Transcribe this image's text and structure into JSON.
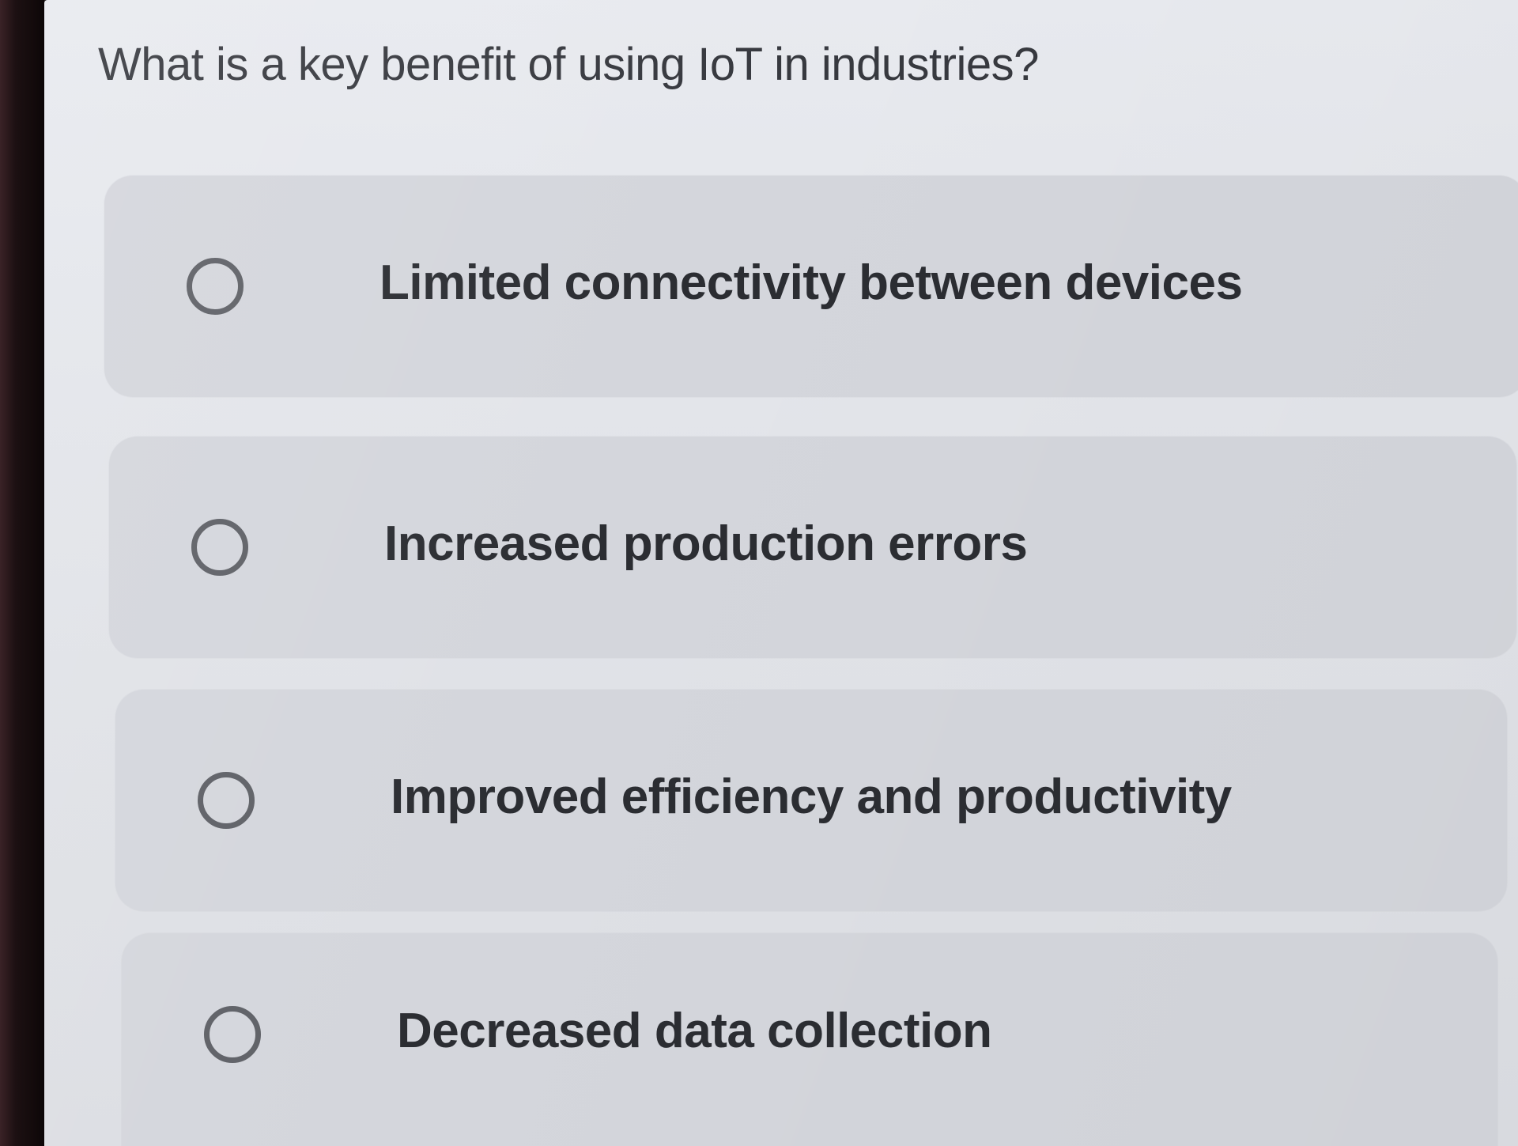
{
  "quiz": {
    "question": "What is a key benefit of using IoT in industries?",
    "options": [
      {
        "label": "Limited connectivity between devices",
        "selected": false
      },
      {
        "label": "Increased production errors",
        "selected": false
      },
      {
        "label": "Improved efficiency and productivity",
        "selected": false
      },
      {
        "label": "Decreased data collection",
        "selected": false
      }
    ]
  },
  "colors": {
    "screen_background": "#e3e5ea",
    "option_background": "#d4d6dc",
    "text": "#2b2d32",
    "radio_border": "#5e6066"
  },
  "icons": {
    "radio": "radio-unchecked-icon"
  }
}
